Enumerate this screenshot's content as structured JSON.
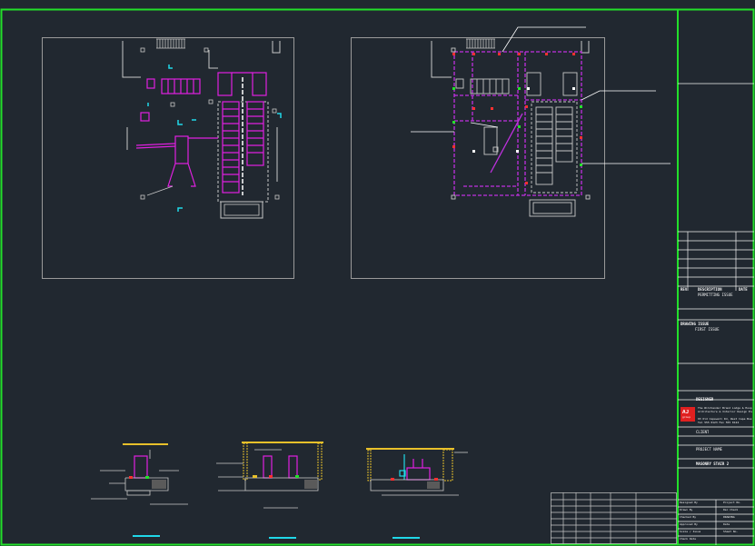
{
  "title_block": {
    "rev_header": {
      "rev": "REV",
      "description": "DESCRIPTION",
      "date": "DATE"
    },
    "issue_note": "PERMITTING ISSUE",
    "drawing_issue_label": "DRAWING ISSUE",
    "drawing_issue_value": "FIRST ISSUE",
    "designer_label": "DESIGNER",
    "company_lines": [
      "The Wildlander Brand Lodge & Hospitality Group",
      "Architecture & Interior Design Engineering Consultant",
      "",
      "93 Old Capewell Rd, West Cape Boston Office",
      "Tel 555 0123  Fax 555 0124"
    ],
    "client_label": "CLIENT",
    "project_label": "PROJECT NAME",
    "drawing_title": "MASONRY STAIR 2",
    "signoff": [
      {
        "label": "Designed By",
        "value": "Project No."
      },
      {
        "label": "Drawn By",
        "value": "Dec Check"
      },
      {
        "label": "Checked By",
        "value": "DRAWING"
      },
      {
        "label": "Approved By",
        "value": "Date"
      },
      {
        "label": "Scale / Issue",
        "value": "Sheet No."
      },
      {
        "label": "Check Date",
        "value": ""
      }
    ]
  },
  "colors": {
    "background": "#212830",
    "border": "#22e02a",
    "line": "#c8c8c8",
    "magenta": "#e020e0",
    "cyan": "#20d8e8",
    "yellow": "#e8c02a",
    "red": "#ff3030",
    "green": "#22e02a"
  },
  "logo": {
    "text": "AJ",
    "sub": "group"
  }
}
